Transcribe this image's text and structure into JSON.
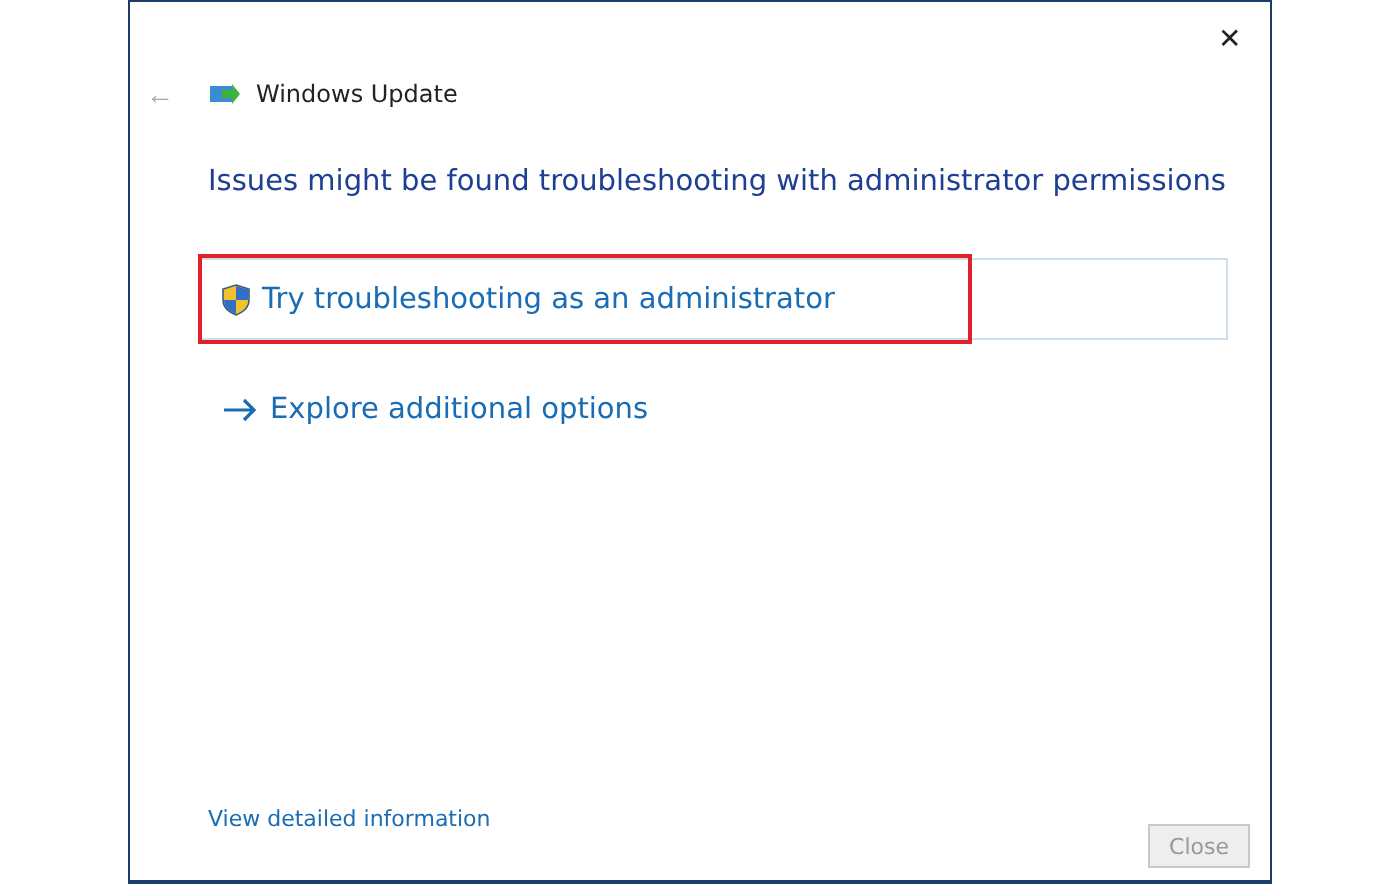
{
  "window": {
    "title": "Windows Update",
    "close_glyph": "✕",
    "back_glyph": "←"
  },
  "heading": "Issues might be found troubleshooting with administrator permissions",
  "options": [
    {
      "kind": "shield",
      "label": "Try troubleshooting as an administrator",
      "highlighted": true
    },
    {
      "kind": "arrow",
      "label": "Explore additional options",
      "highlighted": false
    }
  ],
  "details_link": "View detailed information",
  "close_button": {
    "label": "Close",
    "disabled": true
  }
}
